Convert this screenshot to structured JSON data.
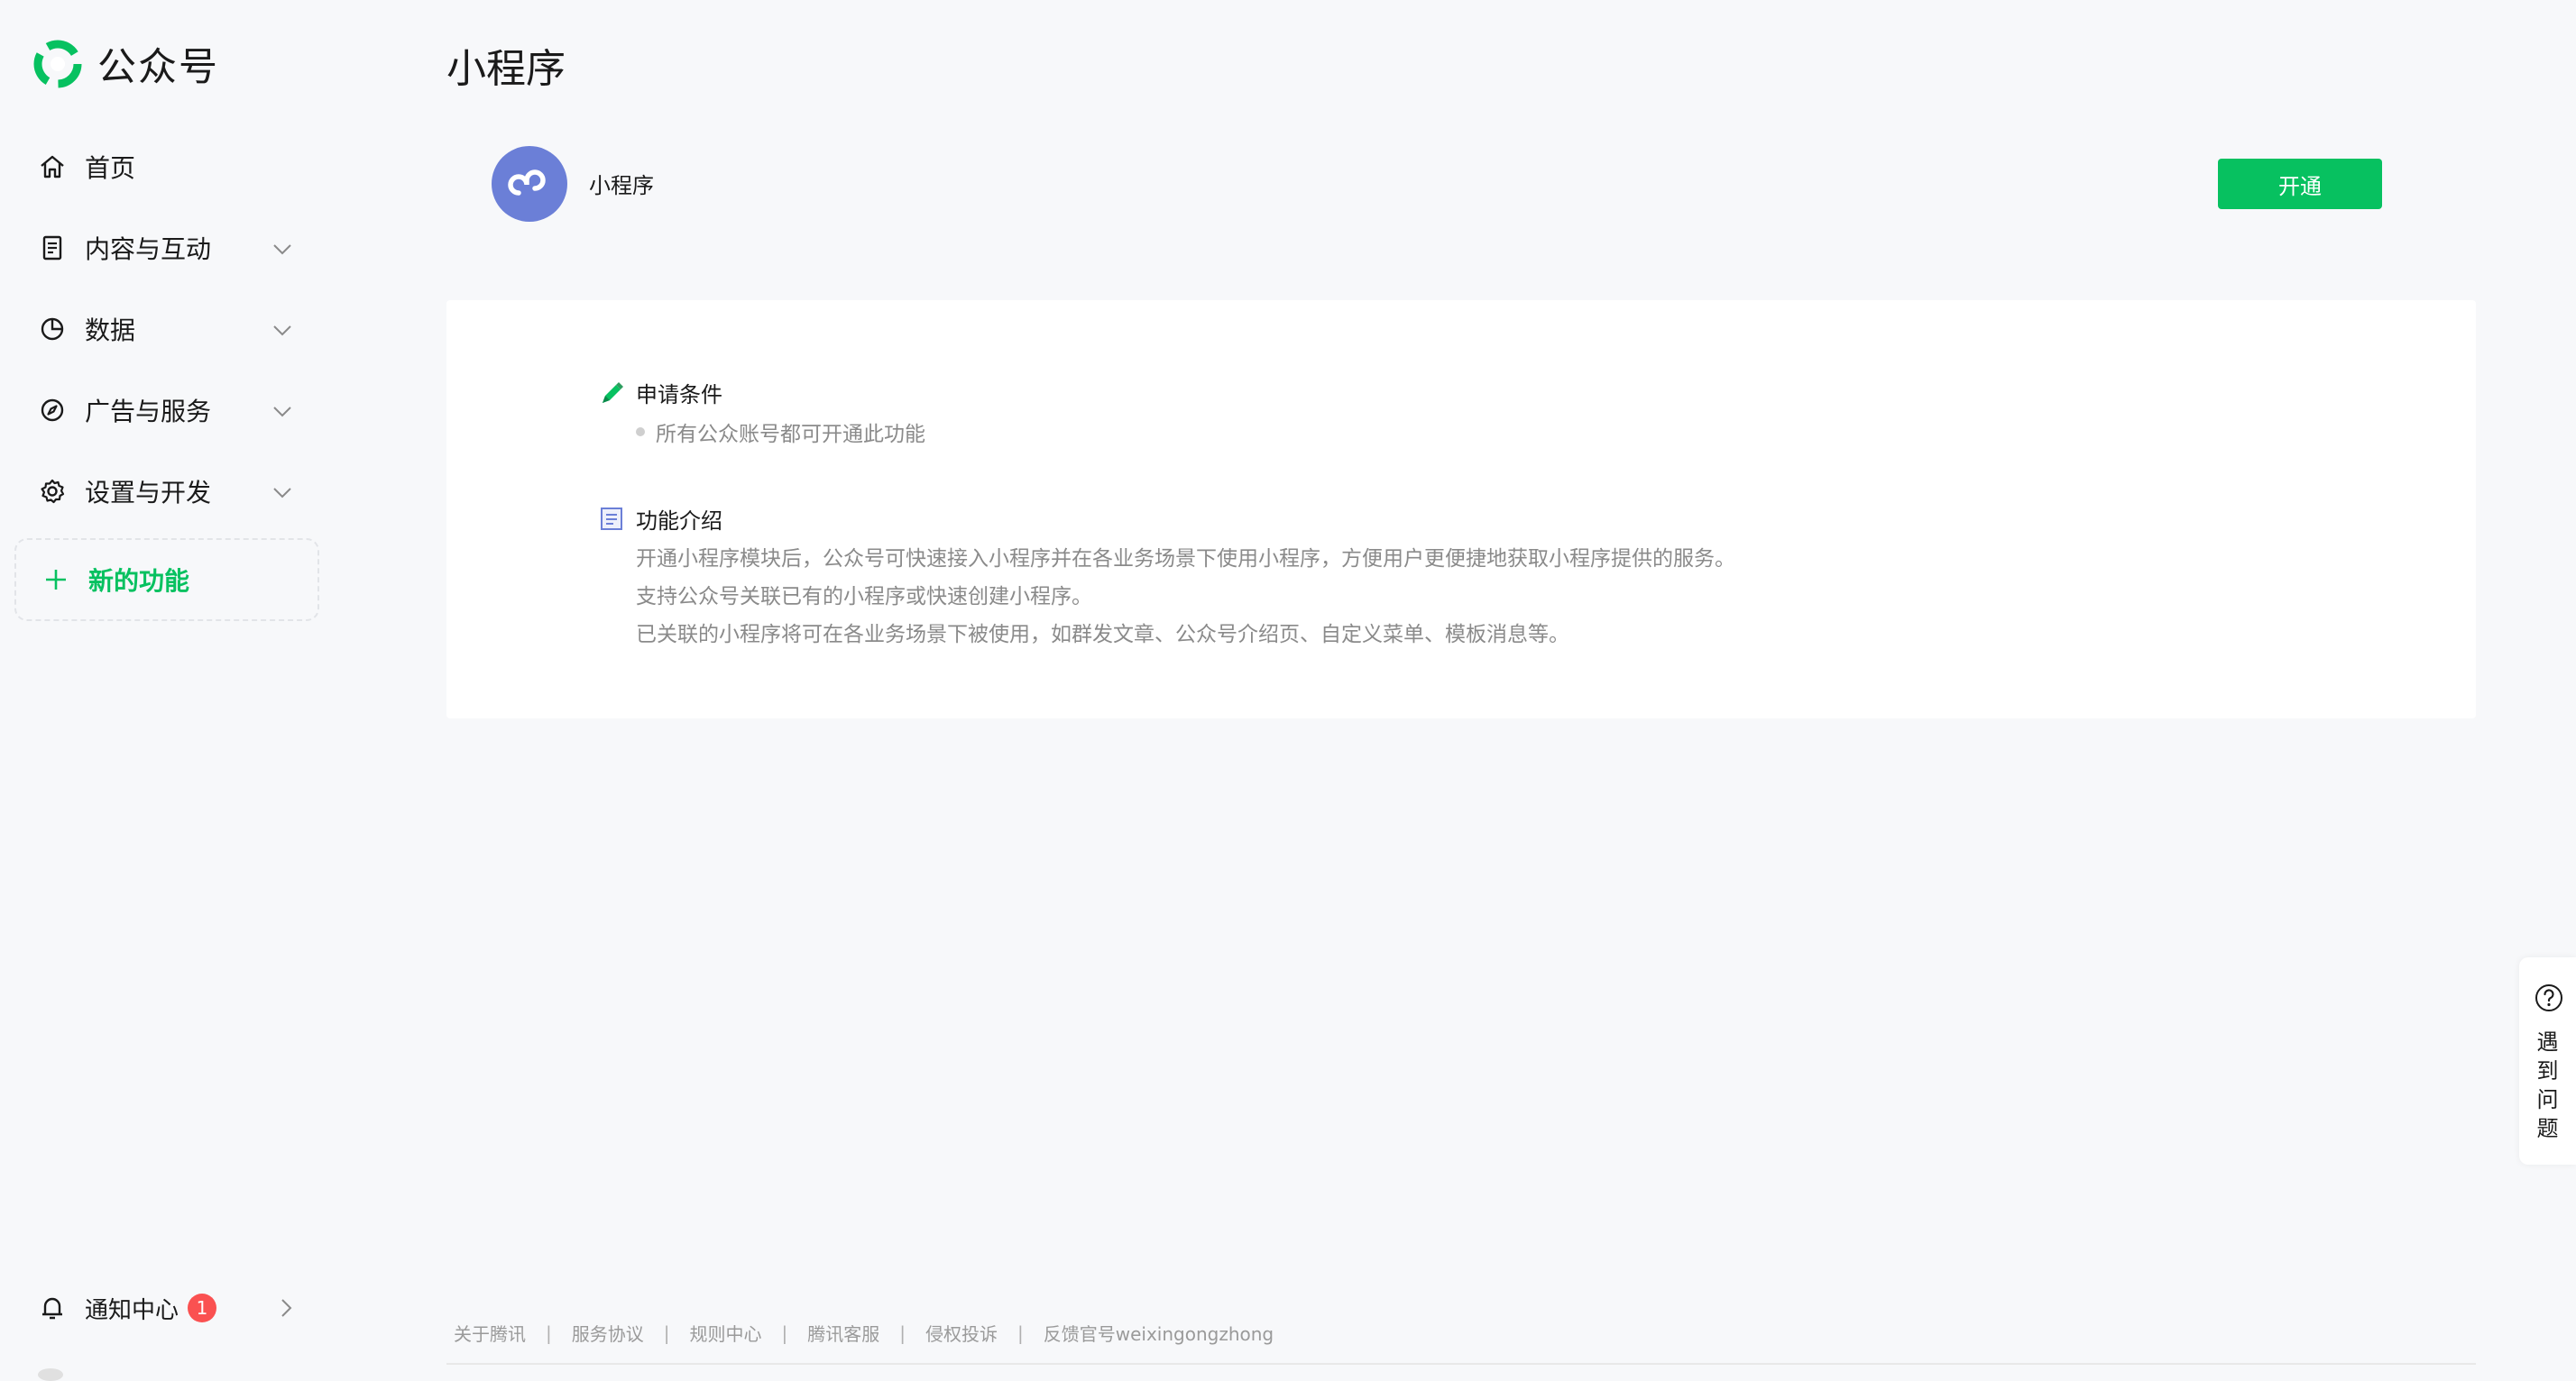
{
  "brand": {
    "name": "公众号",
    "logo_icon": "wechat-official-accounts-logo",
    "brand_color": "#07c160"
  },
  "sidebar": {
    "items": [
      {
        "label": "首页",
        "icon": "home-icon",
        "expandable": false
      },
      {
        "label": "内容与互动",
        "icon": "document-icon",
        "expandable": true
      },
      {
        "label": "数据",
        "icon": "pie-chart-icon",
        "expandable": true
      },
      {
        "label": "广告与服务",
        "icon": "compass-icon",
        "expandable": true
      },
      {
        "label": "设置与开发",
        "icon": "gear-icon",
        "expandable": true
      }
    ],
    "new_feature": {
      "label": "新的功能",
      "icon": "plus-icon",
      "color": "#07c160"
    },
    "notification": {
      "label": "通知中心",
      "count": "1",
      "icon": "bell-icon",
      "badge_color": "#fa5151"
    }
  },
  "page": {
    "title": "小程序",
    "feature": {
      "name": "小程序",
      "icon": "mini-program-icon",
      "icon_color": "#6b7fd7",
      "action_label": "开通"
    }
  },
  "card": {
    "conditions": {
      "title": "申请条件",
      "icon": "pen-icon",
      "items": [
        "所有公众账号都可开通此功能"
      ]
    },
    "intro": {
      "title": "功能介绍",
      "icon": "list-doc-icon",
      "lines": [
        "开通小程序模块后，公众号可快速接入小程序并在各业务场景下使用小程序，方便用户更便捷地获取小程序提供的服务。",
        "支持公众号关联已有的小程序或快速创建小程序。",
        "已关联的小程序将可在各业务场景下被使用，如群发文章、公众号介绍页、自定义菜单、模板消息等。"
      ]
    }
  },
  "footer": {
    "links": [
      "关于腾讯",
      "服务协议",
      "规则中心",
      "腾讯客服",
      "侵权投诉",
      "反馈官号weixingongzhong"
    ],
    "separator": "|"
  },
  "help": {
    "chars": [
      "遇",
      "到",
      "问",
      "题"
    ],
    "icon": "question-circle-icon"
  }
}
